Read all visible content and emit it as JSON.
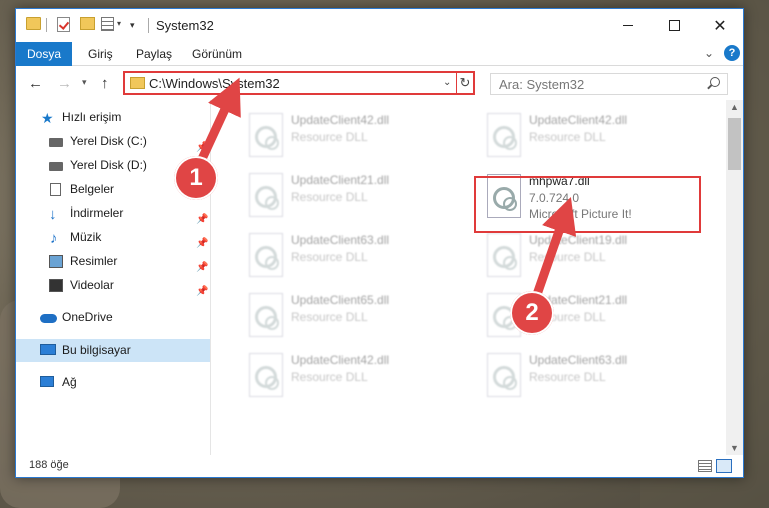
{
  "window": {
    "title": "System32"
  },
  "ribbon": {
    "tabs": [
      "Dosya",
      "Giriş",
      "Paylaş",
      "Görünüm"
    ]
  },
  "address": {
    "path": "C:\\Windows\\System32"
  },
  "search": {
    "placeholder": "Ara: System32"
  },
  "sidebar": {
    "items": [
      {
        "label": "Hızlı erişim",
        "icon": "star-icon"
      },
      {
        "label": "Yerel Disk (C:)",
        "icon": "drive-icon"
      },
      {
        "label": "Yerel Disk (D:)",
        "icon": "drive-icon"
      },
      {
        "label": "Belgeler",
        "icon": "document-icon"
      },
      {
        "label": "İndirmeler",
        "icon": "download-icon"
      },
      {
        "label": "Müzik",
        "icon": "music-icon"
      },
      {
        "label": "Resimler",
        "icon": "pictures-icon"
      },
      {
        "label": "Videolar",
        "icon": "video-icon"
      },
      {
        "label": "OneDrive",
        "icon": "cloud-icon"
      },
      {
        "label": "Bu bilgisayar",
        "icon": "computer-icon"
      },
      {
        "label": "Ağ",
        "icon": "network-icon"
      }
    ]
  },
  "files": {
    "left": [
      {
        "name": "UpdateClient42.dll",
        "type": "Resource DLL"
      },
      {
        "name": "UpdateClient21.dll",
        "type": "Resource DLL"
      },
      {
        "name": "UpdateClient63.dll",
        "type": "Resource DLL"
      },
      {
        "name": "UpdateClient65.dll",
        "type": "Resource DLL"
      },
      {
        "name": "UpdateClient42.dll",
        "type": "Resource DLL"
      }
    ],
    "right": [
      {
        "name": "UpdateClient42.dll",
        "type": "Resource DLL"
      },
      {
        "name": "mhpwa7.dll",
        "version": "7.0.724.0",
        "description": "Microsoft Picture It!"
      },
      {
        "name": "UpdateClient19.dll",
        "type": "Resource DLL"
      },
      {
        "name": "UpdateClient21.dll",
        "type": "Resource DLL"
      },
      {
        "name": "UpdateClient63.dll",
        "type": "Resource DLL"
      }
    ]
  },
  "status": {
    "count": "188 öğe"
  },
  "annotations": {
    "step1": "1",
    "step2": "2",
    "color": "#e04545"
  }
}
